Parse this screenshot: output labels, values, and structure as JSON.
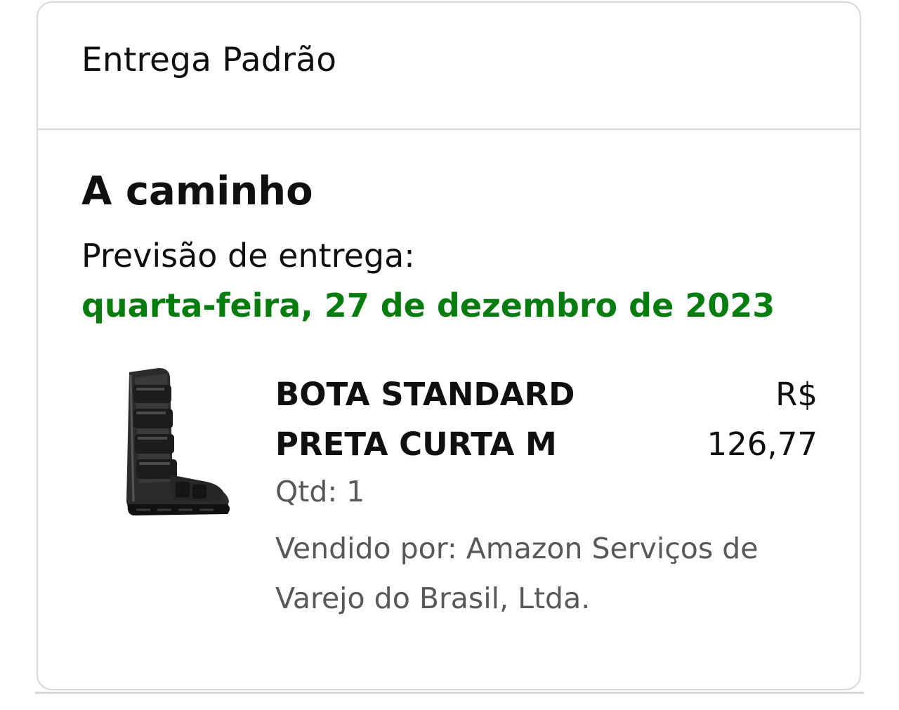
{
  "shipment": {
    "method": "Entrega Padrão",
    "status": "A caminho",
    "eta_label": "Previsão de entrega:",
    "eta_date": "quarta-feira, 27 de dezembro de 2023",
    "eta_color": "#067d0e"
  },
  "item": {
    "image_icon": "walking-boot-icon",
    "name_line1": "BOTA STANDARD",
    "name_line2": "PRETA CURTA M",
    "currency": "R$",
    "price": "126,77",
    "qty": "Qtd: 1",
    "seller_line1": "Vendido por: Amazon Serviços de",
    "seller_line2": "Varejo do Brasil, Ltda."
  }
}
